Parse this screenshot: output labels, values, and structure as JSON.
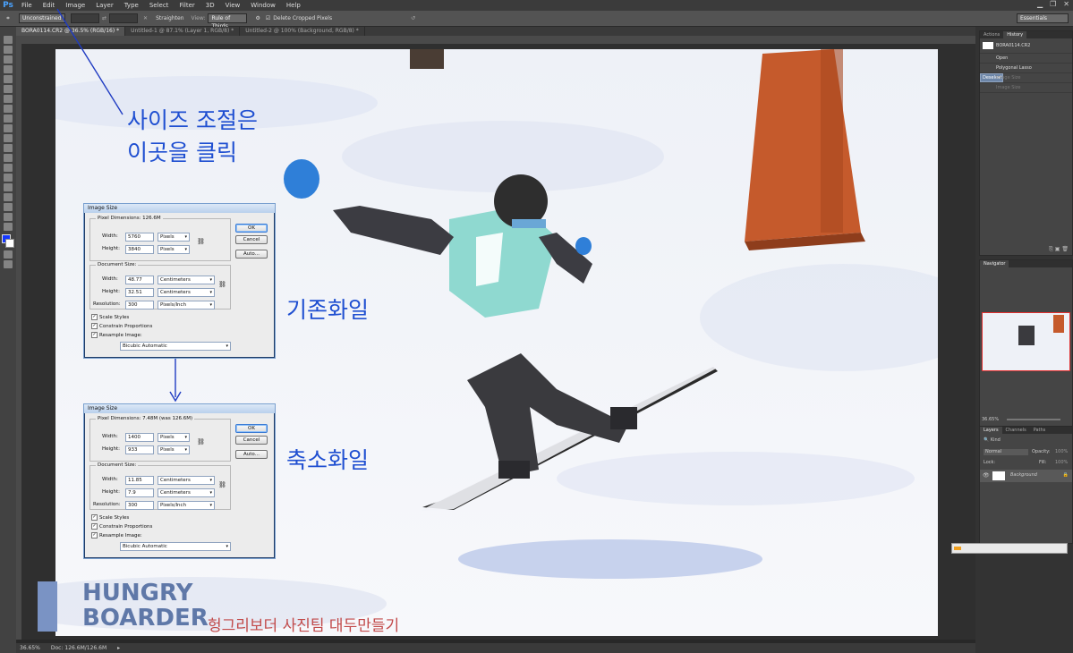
{
  "app": {
    "logo": "Ps"
  },
  "menu": [
    "File",
    "Edit",
    "Image",
    "Layer",
    "Type",
    "Select",
    "Filter",
    "3D",
    "View",
    "Window",
    "Help"
  ],
  "options_bar": {
    "ratio": "Unconstrained",
    "straighten": "Straighten",
    "view_label": "View:",
    "view_value": "Rule of Thirds",
    "delete_cropped": "Delete Cropped Pixels",
    "workspace": "Essentials"
  },
  "doc_tabs": [
    "BORA0114.CR2 @ 36.5% (RGB/16) *",
    "Untitled-1 @ 87.1% (Layer 1, RGB/8) *",
    "Untitled-2 @ 100% (Background, RGB/8) *"
  ],
  "status": {
    "zoom": "36.65%",
    "doc": "Doc: 126.6M/126.6M"
  },
  "annotations": {
    "resize_line1": "사이즈 조절은",
    "resize_line2": "이곳을 클릭",
    "original": "기존화일",
    "reduced": "축소화일",
    "brand_line1": "HUNGRY",
    "brand_line2": "BOARDER",
    "brand_caption": "헝그리보더 사진팀 대두만들기"
  },
  "dialog_original": {
    "title": "Image Size",
    "pixel_dimensions": "Pixel Dimensions: 126.6M",
    "width_label": "Width:",
    "width": "5760",
    "width_unit": "Pixels",
    "height_label": "Height:",
    "height": "3840",
    "height_unit": "Pixels",
    "document_size": "Document Size:",
    "doc_width": "48.77",
    "doc_width_unit": "Centimeters",
    "doc_height": "32.51",
    "doc_height_unit": "Centimeters",
    "resolution_label": "Resolution:",
    "resolution": "300",
    "resolution_unit": "Pixels/Inch",
    "scale_styles": "Scale Styles",
    "constrain": "Constrain Proportions",
    "resample": "Resample Image:",
    "resample_method": "Bicubic Automatic",
    "ok": "OK",
    "cancel": "Cancel",
    "auto": "Auto..."
  },
  "dialog_reduced": {
    "title": "Image Size",
    "pixel_dimensions": "Pixel Dimensions: 7.48M (was 126.6M)",
    "width_label": "Width:",
    "width": "1400",
    "width_unit": "Pixels",
    "height_label": "Height:",
    "height": "933",
    "height_unit": "Pixels",
    "document_size": "Document Size:",
    "doc_width": "11.85",
    "doc_width_unit": "Centimeters",
    "doc_height": "7.9",
    "doc_height_unit": "Centimeters",
    "resolution_label": "Resolution:",
    "resolution": "300",
    "resolution_unit": "Pixels/Inch",
    "scale_styles": "Scale Styles",
    "constrain": "Constrain Proportions",
    "resample": "Resample Image:",
    "resample_method": "Bicubic Automatic",
    "ok": "OK",
    "cancel": "Cancel",
    "auto": "Auto..."
  },
  "history_panel": {
    "tabs": [
      "Actions",
      "History"
    ],
    "snapshot": "BORA0114.CR2",
    "items": [
      "Open",
      "Polygonal Lasso",
      "Deselect",
      "Image Size",
      "Image Size"
    ]
  },
  "navigator": {
    "tab": "Navigator",
    "zoom": "36.65%"
  },
  "layers_panel": {
    "tabs": [
      "Layers",
      "Channels",
      "Paths"
    ],
    "kind": "Kind",
    "blend": "Normal",
    "opacity_label": "Opacity:",
    "opacity": "100%",
    "lock_label": "Lock:",
    "fill_label": "Fill:",
    "fill": "100%",
    "layer_name": "Background"
  }
}
